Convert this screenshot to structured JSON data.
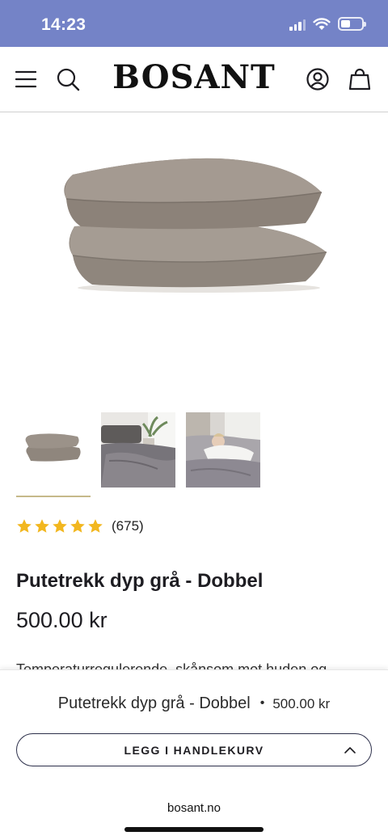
{
  "status_bar": {
    "time": "14:23",
    "battery_level": 0.44
  },
  "header": {
    "logo": "BOSANT",
    "menu_icon": "hamburger-menu-icon",
    "search_icon": "search-icon",
    "account_icon": "account-icon",
    "cart_icon": "shopping-bag-icon"
  },
  "gallery": {
    "main_image": "pillowcases-stacked-taupe",
    "thumbnails": [
      {
        "name": "thumb-pillows",
        "selected": true
      },
      {
        "name": "thumb-bedroom-grey-bedding",
        "selected": false
      },
      {
        "name": "thumb-woman-in-bed",
        "selected": false
      }
    ]
  },
  "product": {
    "rating_stars": 5,
    "rating_count": "(675)",
    "title": "Putetrekk dyp grå - Dobbel",
    "price": "500.00 kr",
    "description": "Temperaturregulerende, skånsom mot huden og"
  },
  "sticky_bar": {
    "title": "Putetrekk dyp grå - Dobbel",
    "separator": "•",
    "price": "500.00 kr",
    "button_label": "LEGG I HANDLEKURV"
  },
  "browser": {
    "url": "bosant.no"
  },
  "colors": {
    "status_bar": "#7483c7",
    "star": "#f2b71f",
    "button_border": "#2c2f4a",
    "thumb_underline": "#c6b98a",
    "pillow": "#9a9189"
  }
}
